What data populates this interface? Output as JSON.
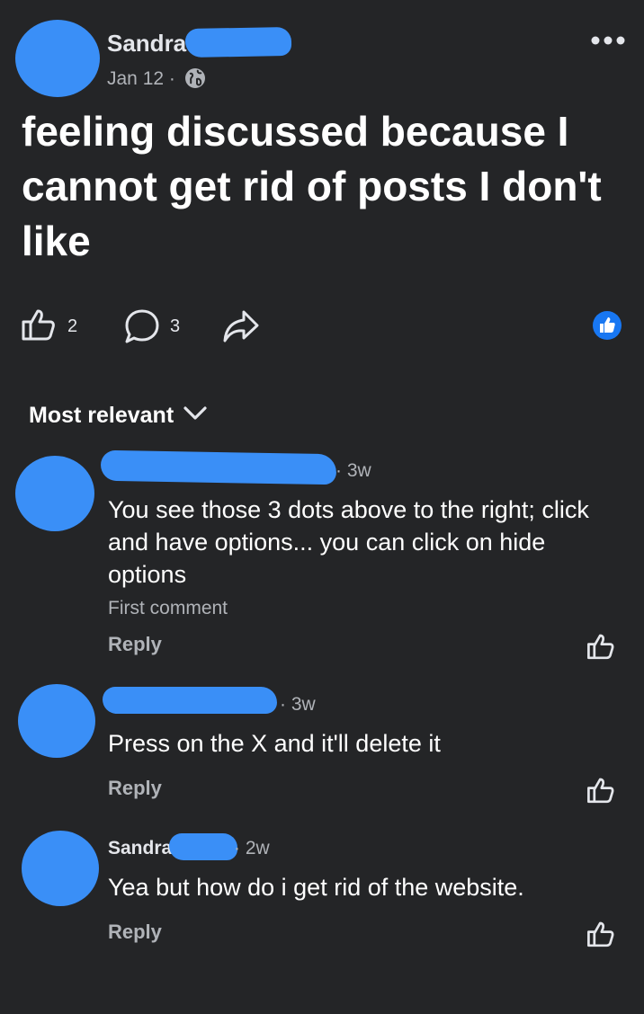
{
  "post": {
    "author": "Sandra",
    "date": "Jan 12 ·",
    "text_lines": [
      "feeling discussed because I",
      "cannot get rid of posts I don't",
      "like"
    ],
    "like_count": "2",
    "comment_count": "3"
  },
  "sort": {
    "label": "Most relevant"
  },
  "comments": [
    {
      "time": "· 3w",
      "text_lines": [
        "You see those 3 dots above to the right; click",
        "and have options... you can click on hide",
        "options"
      ],
      "badge": "First comment",
      "reply": "Reply"
    },
    {
      "time": "· 3w",
      "text_lines": [
        "Press on the X and it'll delete it"
      ],
      "reply": "Reply"
    },
    {
      "author": "Sandra",
      "time": "· 2w",
      "text_lines": [
        "Yea but how do i get rid of the website."
      ],
      "reply": "Reply"
    }
  ],
  "colors": {
    "background": "#242527",
    "redaction": "#3a8ff7",
    "like_badge": "#1877f2"
  },
  "icons": {
    "more": "more-dots-icon",
    "globe": "globe-icon",
    "like": "thumbs-up-icon",
    "comment": "speech-bubble-icon",
    "share": "share-arrow-icon",
    "chevron": "chevron-down-icon"
  }
}
